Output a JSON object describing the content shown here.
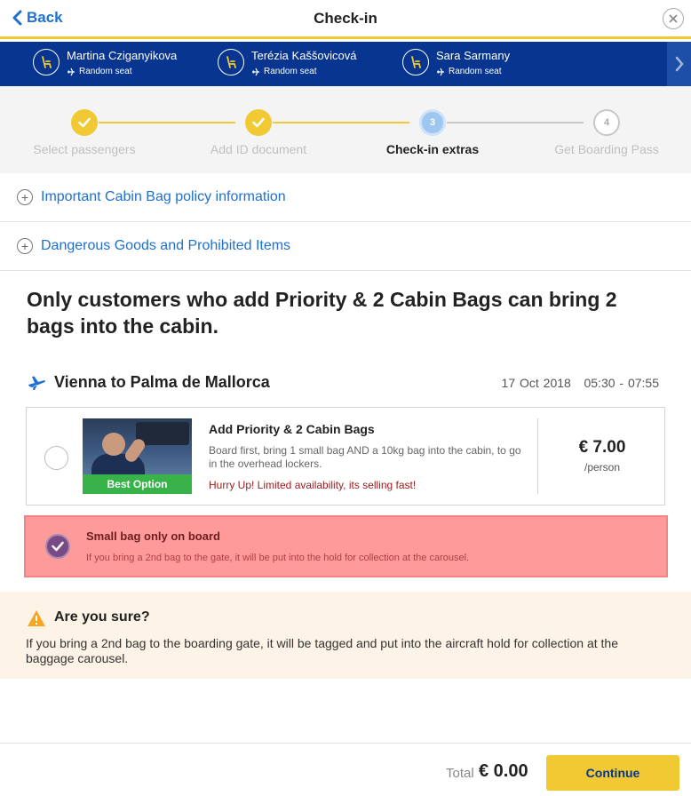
{
  "header": {
    "back_label": "Back",
    "title": "Check-in"
  },
  "passengers": [
    {
      "name": "Martina Cziganyikova",
      "seat": "Random seat"
    },
    {
      "name": "Terézia Kaššovicová",
      "seat": "Random seat"
    },
    {
      "name": "Sara Sarmany",
      "seat": "Random seat"
    }
  ],
  "steps": [
    {
      "label": "Select passengers",
      "state": "done"
    },
    {
      "label": "Add ID document",
      "state": "done"
    },
    {
      "label": "Check-in extras",
      "number": "3",
      "state": "active"
    },
    {
      "label": "Get Boarding Pass",
      "number": "4",
      "state": "future"
    }
  ],
  "accordions": [
    {
      "label": "Important Cabin Bag policy information"
    },
    {
      "label": "Dangerous Goods and Prohibited Items"
    }
  ],
  "headline": "Only customers who add Priority & 2 Cabin Bags can bring 2 bags into the cabin.",
  "flight": {
    "route": "Vienna to Palma de Mallorca",
    "date": "17 Oct 2018",
    "time": "05:30 - 07:55"
  },
  "priority_option": {
    "badge": "Best Option",
    "title": "Add Priority & 2 Cabin Bags",
    "description": "Board first, bring 1 small bag AND a 10kg bag into the cabin, to go in the overhead lockers.",
    "urgency": "Hurry Up! Limited availability, its selling fast!",
    "price": "€ 7.00",
    "per": "/person",
    "selected": false
  },
  "small_bag_option": {
    "title": "Small bag only on board",
    "description": "If you bring a 2nd bag to the gate, it will be put into the hold for collection at the carousel.",
    "selected": true
  },
  "warning": {
    "title": "Are you sure?",
    "text": "If you bring a 2nd bag to the boarding gate, it will be tagged and put into the aircraft hold for collection at the baggage carousel."
  },
  "footer": {
    "total_label": "Total",
    "total_value": "€ 0.00",
    "continue_label": "Continue"
  },
  "colors": {
    "brand_blue": "#073590",
    "brand_yellow": "#f1c933",
    "link_blue": "#1e70d2",
    "error_pink": "#ff9a9a",
    "success_green": "#37b34a"
  }
}
